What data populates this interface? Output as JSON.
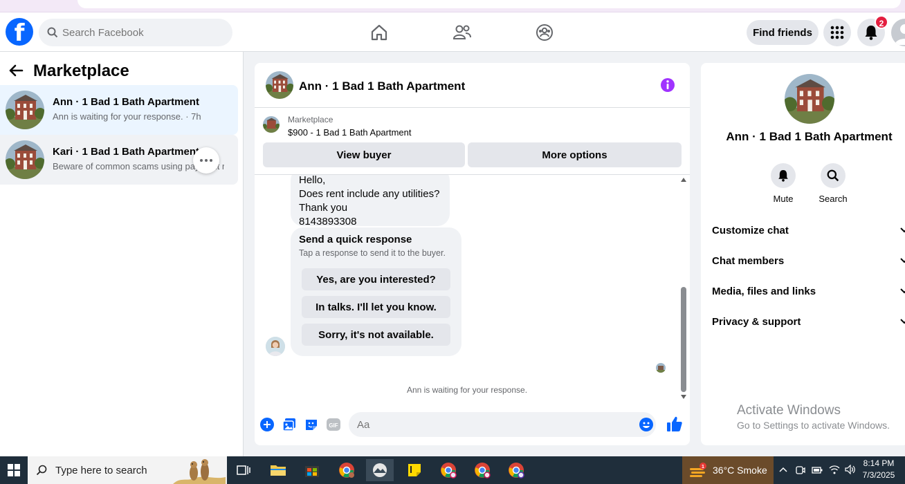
{
  "topnav": {
    "logo": "f",
    "search_placeholder": "Search Facebook",
    "find_friends": "Find friends",
    "notification_count": "2"
  },
  "left": {
    "title": "Marketplace",
    "conversations": [
      {
        "title": "Ann · 1 Bad 1 Bath Apartment",
        "subtitle": "Ann is waiting for your response. · 7h"
      },
      {
        "title": "Kari · 1 Bad 1 Bath Apartment",
        "subtitle": "Beware of common scams using payment rd"
      }
    ]
  },
  "chat": {
    "title": "Ann · 1 Bad 1 Bath Apartment",
    "listing_source": "Marketplace",
    "listing_price": "$900 - 1 Bad 1 Bath Apartment",
    "view_buyer": "View buyer",
    "more_options": "More options",
    "message_lines": [
      "Hello,",
      "Does rent include any utilities?",
      "Thank you",
      "8143893308"
    ],
    "quick_title": "Send a quick response",
    "quick_sub": "Tap a response to send it to the buyer.",
    "quick_options": [
      "Yes, are you interested?",
      "In talks. I'll let you know.",
      "Sorry, it's not available."
    ],
    "waiting": "Ann is waiting for your response.",
    "input_placeholder": "Aa"
  },
  "right": {
    "title": "Ann · 1 Bad 1 Bath Apartment",
    "mute": "Mute",
    "search": "Search",
    "sections": [
      "Customize chat",
      "Chat members",
      "Media, files and links",
      "Privacy & support"
    ]
  },
  "watermark": {
    "line1": "Activate Windows",
    "line2": "Go to Settings to activate Windows."
  },
  "taskbar": {
    "search_placeholder": "Type here to search",
    "weather": "36°C  Smoke",
    "weather_alert": "1",
    "time": "8:14 PM",
    "date": "7/3/2025"
  },
  "colors": {
    "facebook_blue": "#0866ff",
    "info_purple": "#a033ff",
    "badge_red": "#e41e3f"
  }
}
